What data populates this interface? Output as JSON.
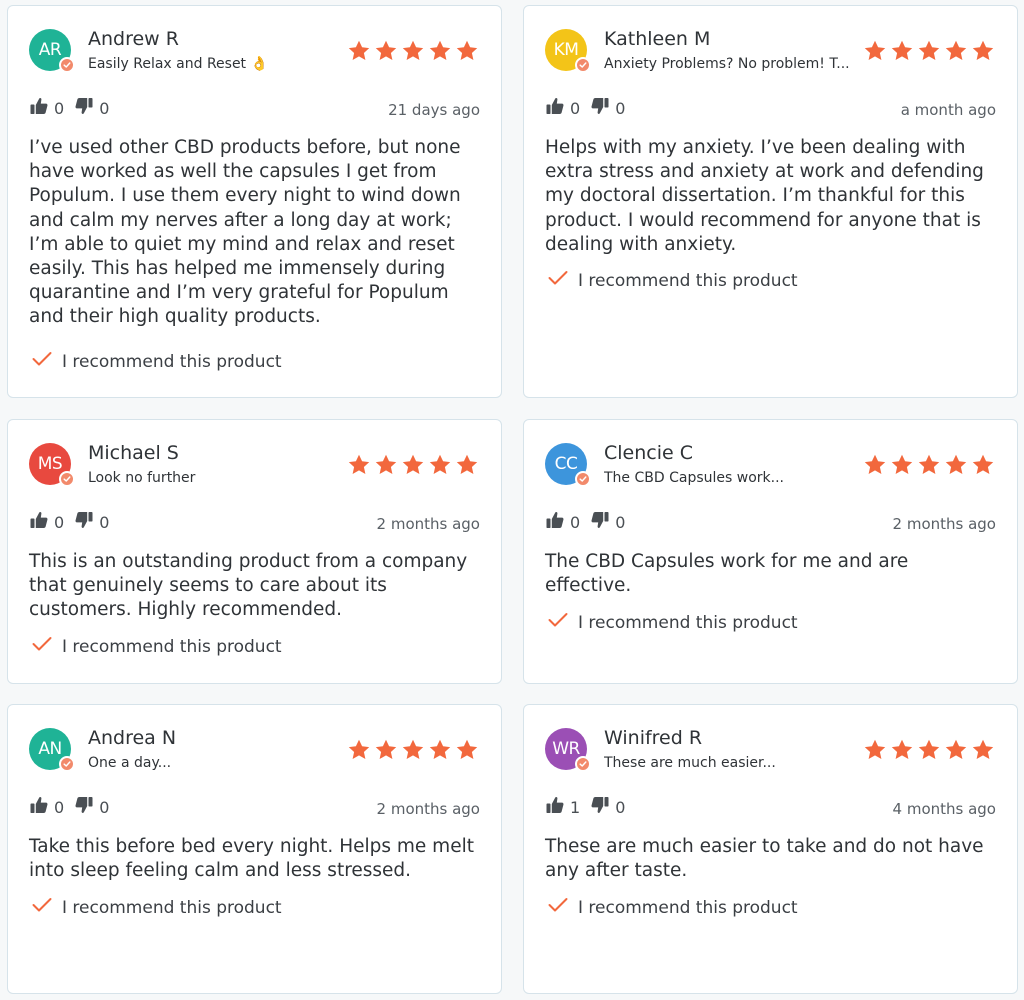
{
  "colors": {
    "star": "#f2683d",
    "accent": "#f28a6b",
    "check": "#f2683d",
    "border": "#d6e3ea"
  },
  "icons": {
    "star": "star-icon",
    "thumbs_up": "thumbs-up-icon",
    "thumbs_down": "thumbs-down-icon",
    "check": "check-icon",
    "verified": "verified-badge-icon"
  },
  "reviews": [
    {
      "initials": "AR",
      "avatar_color": "#1fb396",
      "name": "Andrew R",
      "headline": "Easily Relax and Reset 👌",
      "rating": 5,
      "helpful": "0",
      "unhelpful": "0",
      "date": "21 days ago",
      "body": "I’ve used other CBD products before, but none have worked as well the capsules I get from Populum. I use them every night to wind down and calm my nerves after a long day at work; I’m able to quiet my mind and relax and reset easily. This has helped me immensely during quarantine and I’m very grateful for Populum and their high quality products.",
      "recommend": "I recommend this product"
    },
    {
      "initials": "KM",
      "avatar_color": "#f3c418",
      "name": "Kathleen M",
      "headline": "Anxiety Problems? No problem! T...",
      "rating": 5,
      "helpful": "0",
      "unhelpful": "0",
      "date": "a month ago",
      "body": "Helps with my anxiety. I’ve been dealing with extra stress and anxiety at work and defending my doctoral dissertation. I’m thankful for this product. I would recommend for anyone that is dealing with anxiety.",
      "recommend": "I recommend this product"
    },
    {
      "initials": "MS",
      "avatar_color": "#e8493f",
      "name": "Michael S",
      "headline": "Look no further",
      "rating": 5,
      "helpful": "0",
      "unhelpful": "0",
      "date": "2 months ago",
      "body": "This is an outstanding product from a company that genuinely seems to care about its customers. Highly recommended.",
      "recommend": "I recommend this product"
    },
    {
      "initials": "CC",
      "avatar_color": "#3d95dc",
      "name": "Clencie C",
      "headline": "The CBD Capsules work...",
      "rating": 5,
      "helpful": "0",
      "unhelpful": "0",
      "date": "2 months ago",
      "body": "The CBD Capsules work for me and are effective.",
      "recommend": "I recommend this product"
    },
    {
      "initials": "AN",
      "avatar_color": "#1fb396",
      "name": "Andrea N",
      "headline": "One a day...",
      "rating": 5,
      "helpful": "0",
      "unhelpful": "0",
      "date": "2 months ago",
      "body": "Take this before bed every night.  Helps me melt into sleep feeling calm and less stressed.",
      "recommend": "I recommend this product"
    },
    {
      "initials": "WR",
      "avatar_color": "#9b4fb5",
      "name": "Winifred R",
      "headline": "These are much easier...",
      "rating": 5,
      "helpful": "1",
      "unhelpful": "0",
      "date": "4 months ago",
      "body": "These are much easier to take and do not have any after taste.",
      "recommend": "I recommend this product"
    }
  ]
}
